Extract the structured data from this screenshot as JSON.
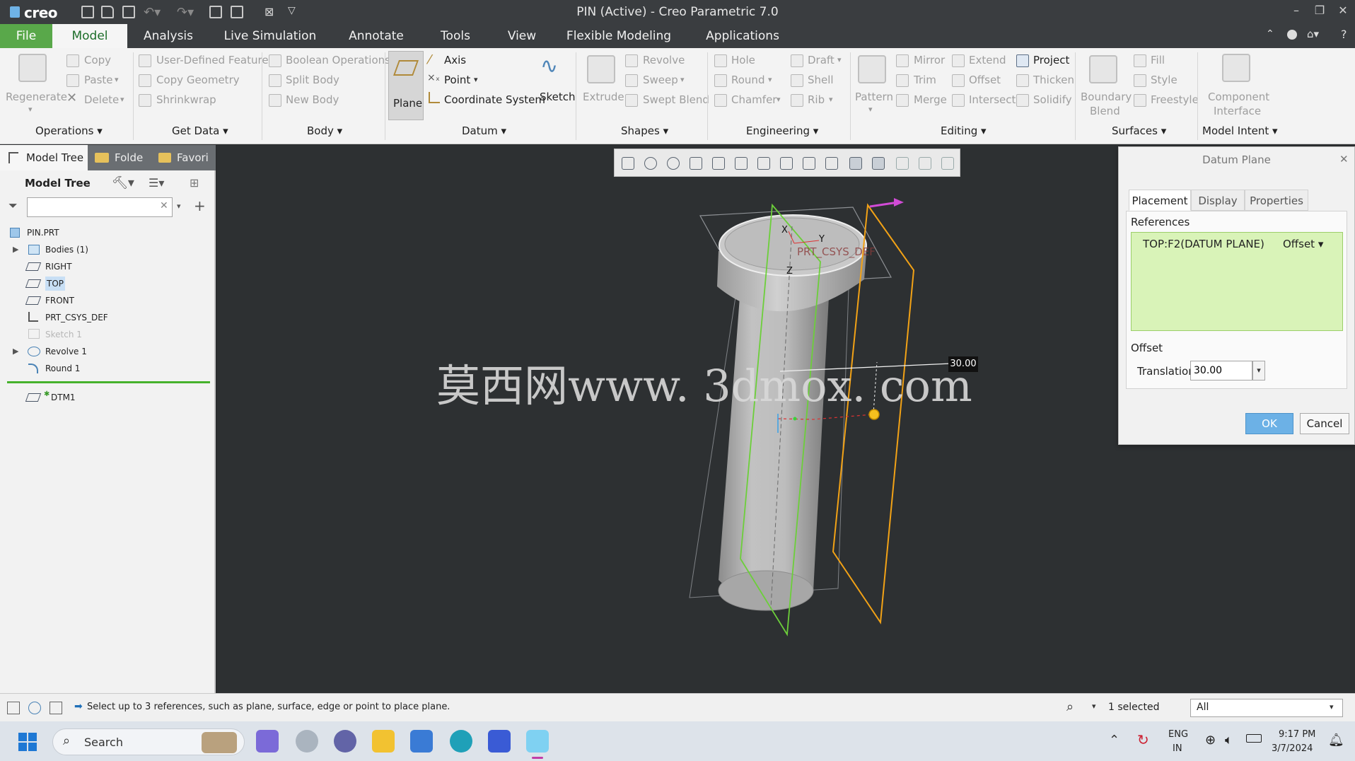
{
  "titlebar": {
    "logo": "creo",
    "title": "PIN (Active) - Creo Parametric 7.0"
  },
  "menu": {
    "file": "File",
    "tabs": [
      "Model",
      "Analysis",
      "Live Simulation",
      "Annotate",
      "Tools",
      "View",
      "Flexible Modeling",
      "Applications"
    ]
  },
  "ribbon": {
    "regenerate": "Regenerate",
    "copy": "Copy",
    "paste": "Paste",
    "delete": "Delete",
    "user_defined_feature": "User-Defined Feature",
    "copy_geometry": "Copy Geometry",
    "shrinkwrap": "Shrinkwrap",
    "boolean_operations": "Boolean Operations",
    "split_body": "Split Body",
    "new_body": "New Body",
    "plane": "Plane",
    "axis": "Axis",
    "point": "Point",
    "coordinate_system": "Coordinate System",
    "sketch": "Sketch",
    "extrude": "Extrude",
    "revolve": "Revolve",
    "sweep": "Sweep",
    "swept_blend": "Swept Blend",
    "hole": "Hole",
    "round": "Round",
    "chamfer": "Chamfer",
    "draft": "Draft",
    "shell": "Shell",
    "rib": "Rib",
    "pattern": "Pattern",
    "mirror": "Mirror",
    "trim": "Trim",
    "merge": "Merge",
    "extend": "Extend",
    "offset": "Offset",
    "intersect": "Intersect",
    "project": "Project",
    "thicken": "Thicken",
    "solidify": "Solidify",
    "boundary_blend_1": "Boundary",
    "boundary_blend_2": "Blend",
    "fill": "Fill",
    "style": "Style",
    "freestyle": "Freestyle",
    "component_interface_1": "Component",
    "component_interface_2": "Interface",
    "groups": {
      "operations": "Operations",
      "get_data": "Get Data",
      "body": "Body",
      "datum": "Datum",
      "shapes": "Shapes",
      "engineering": "Engineering",
      "editing": "Editing",
      "surfaces": "Surfaces",
      "model_intent": "Model Intent"
    }
  },
  "leftpanel": {
    "tabs": [
      "Model Tree",
      "Folde",
      "Favori"
    ],
    "header": "Model Tree",
    "search_placeholder": "",
    "items": [
      {
        "label": "PIN.PRT",
        "icon": "part-icon"
      },
      {
        "label": "Bodies (1)",
        "icon": "bodies-icon"
      },
      {
        "label": "RIGHT",
        "icon": "datum-plane-icon"
      },
      {
        "label": "TOP",
        "icon": "datum-plane-icon"
      },
      {
        "label": "FRONT",
        "icon": "datum-plane-icon"
      },
      {
        "label": "PRT_CSYS_DEF",
        "icon": "csys-icon"
      },
      {
        "label": "Sketch 1",
        "icon": "sketch-icon"
      },
      {
        "label": "Revolve 1",
        "icon": "revolve-icon"
      },
      {
        "label": "Round 1",
        "icon": "round-icon"
      },
      {
        "label": "DTM1",
        "icon": "datum-plane-icon"
      }
    ]
  },
  "viewport": {
    "csys_label": "PRT_CSYS_DEF",
    "axis_x": "X",
    "axis_y": "Y",
    "axis_z": "Z",
    "dimension": "30.00",
    "watermark": "莫西网www. 3dmox. com"
  },
  "dialog": {
    "title": "Datum Plane",
    "tabs": [
      "Placement",
      "Display",
      "Properties"
    ],
    "references_label": "References",
    "reference_item": "TOP:F2(DATUM PLANE)",
    "reference_constraint": "Offset",
    "offset_label": "Offset",
    "translation_label": "Translation",
    "translation_value": "30.00",
    "ok": "OK",
    "cancel": "Cancel"
  },
  "statusbar": {
    "message": "Select up to 3 references, such as plane, surface, edge or point to place plane.",
    "selected": "1 selected",
    "filter": "All"
  },
  "taskbar": {
    "search": "Search",
    "lang_1": "ENG",
    "lang_2": "IN",
    "time": "9:17 PM",
    "date": "3/7/2024"
  },
  "colors": {
    "file_tab": "#59a84a",
    "active_tab_text": "#1d6e2a",
    "viewport_bg": "#2d3032",
    "reference_bg": "#d9f3b8",
    "ok_button": "#6cb1e6",
    "new_plane": "#f2a216",
    "selected_plane": "#6ccf3a"
  }
}
